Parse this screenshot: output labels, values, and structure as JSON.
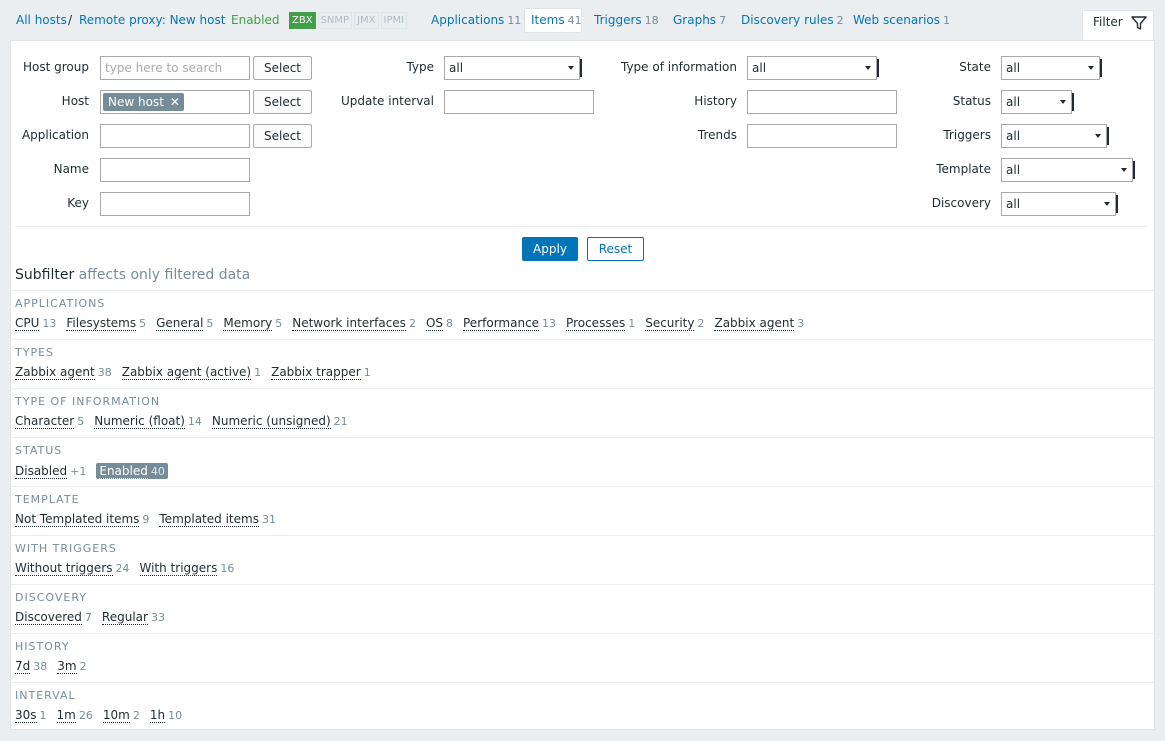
{
  "nav": {
    "all_hosts": "All hosts",
    "separator": "/",
    "host": "Remote proxy: New host",
    "status": "Enabled",
    "availability": [
      {
        "label": "ZBX",
        "active": true
      },
      {
        "label": "SNMP",
        "active": false
      },
      {
        "label": "JMX",
        "active": false
      },
      {
        "label": "IPMI",
        "active": false
      }
    ],
    "tabs": [
      {
        "label": "Applications",
        "count": "11"
      },
      {
        "label": "Items",
        "count": "41"
      },
      {
        "label": "Triggers",
        "count": "18"
      },
      {
        "label": "Graphs",
        "count": "7"
      },
      {
        "label": "Discovery rules",
        "count": "2"
      },
      {
        "label": "Web scenarios",
        "count": "1"
      }
    ],
    "filter_tab": "Filter"
  },
  "filter": {
    "host_group_label": "Host group",
    "host_group_placeholder": "type here to search",
    "host_label": "Host",
    "host_tag": "New host",
    "application_label": "Application",
    "name_label": "Name",
    "key_label": "Key",
    "select_label": "Select",
    "type_label": "Type",
    "type_value": "all",
    "update_interval_label": "Update interval",
    "type_of_information_label": "Type of information",
    "type_of_information_value": "all",
    "history_label": "History",
    "trends_label": "Trends",
    "state_label": "State",
    "state_value": "all",
    "status_label": "Status",
    "status_value": "all",
    "triggers_label": "Triggers",
    "triggers_value": "all",
    "template_label": "Template",
    "template_value": "all",
    "discovery_label": "Discovery",
    "discovery_value": "all",
    "apply": "Apply",
    "reset": "Reset"
  },
  "subfilter": {
    "title": "Subfilter",
    "hint": "affects only filtered data",
    "groups": [
      {
        "header": "APPLICATIONS",
        "items": [
          {
            "name": "CPU",
            "count": "13"
          },
          {
            "name": "Filesystems",
            "count": "5"
          },
          {
            "name": "General",
            "count": "5"
          },
          {
            "name": "Memory",
            "count": "5"
          },
          {
            "name": "Network interfaces",
            "count": "2"
          },
          {
            "name": "OS",
            "count": "8"
          },
          {
            "name": "Performance",
            "count": "13"
          },
          {
            "name": "Processes",
            "count": "1"
          },
          {
            "name": "Security",
            "count": "2"
          },
          {
            "name": "Zabbix agent",
            "count": "3"
          }
        ]
      },
      {
        "header": "TYPES",
        "items": [
          {
            "name": "Zabbix agent",
            "count": "38"
          },
          {
            "name": "Zabbix agent (active)",
            "count": "1"
          },
          {
            "name": "Zabbix trapper",
            "count": "1"
          }
        ]
      },
      {
        "header": "TYPE OF INFORMATION",
        "items": [
          {
            "name": "Character",
            "count": "5"
          },
          {
            "name": "Numeric (float)",
            "count": "14"
          },
          {
            "name": "Numeric (unsigned)",
            "count": "21"
          }
        ]
      },
      {
        "header": "STATUS",
        "items": [
          {
            "name": "Disabled",
            "count": "+1"
          },
          {
            "name": "Enabled",
            "count": "40",
            "active": true
          }
        ]
      },
      {
        "header": "TEMPLATE",
        "items": [
          {
            "name": "Not Templated items",
            "count": "9"
          },
          {
            "name": "Templated items",
            "count": "31"
          }
        ]
      },
      {
        "header": "WITH TRIGGERS",
        "items": [
          {
            "name": "Without triggers",
            "count": "24"
          },
          {
            "name": "With triggers",
            "count": "16"
          }
        ]
      },
      {
        "header": "DISCOVERY",
        "items": [
          {
            "name": "Discovered",
            "count": "7"
          },
          {
            "name": "Regular",
            "count": "33"
          }
        ]
      },
      {
        "header": "HISTORY",
        "items": [
          {
            "name": "7d",
            "count": "38"
          },
          {
            "name": "3m",
            "count": "2"
          }
        ]
      },
      {
        "header": "INTERVAL",
        "items": [
          {
            "name": "30s",
            "count": "1"
          },
          {
            "name": "1m",
            "count": "26"
          },
          {
            "name": "10m",
            "count": "2"
          },
          {
            "name": "1h",
            "count": "10"
          }
        ]
      }
    ]
  }
}
